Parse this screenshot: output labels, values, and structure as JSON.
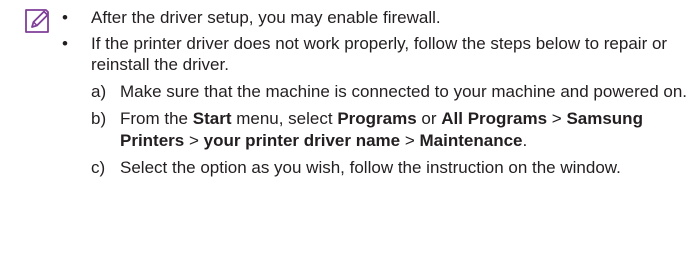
{
  "icons": {
    "note": "note-pencil-icon"
  },
  "colors": {
    "icon_accent": "#7f3f98",
    "text": "#231f20"
  },
  "bullet_glyph": "•",
  "bullets": [
    {
      "text": "After the driver setup, you may enable firewall."
    },
    {
      "text": "If the printer driver does not work properly, follow the steps below to repair or reinstall the driver.",
      "steps": [
        {
          "marker": "a)",
          "parts": [
            {
              "t": "Make sure that the machine is connected to your machine and powered on."
            }
          ]
        },
        {
          "marker": "b)",
          "parts": [
            {
              "t": "From the "
            },
            {
              "t": "Start",
              "b": true
            },
            {
              "t": " menu, select "
            },
            {
              "t": "Programs",
              "b": true
            },
            {
              "t": " or "
            },
            {
              "t": "All Programs",
              "b": true
            },
            {
              "t": " > "
            },
            {
              "t": "Samsung Printers",
              "b": true
            },
            {
              "t": " > "
            },
            {
              "t": "your printer driver name",
              "b": true
            },
            {
              "t": " > "
            },
            {
              "t": "Maintenance",
              "b": true
            },
            {
              "t": "."
            }
          ]
        },
        {
          "marker": "c)",
          "parts": [
            {
              "t": "Select the option as you wish, follow the instruction on the window."
            }
          ]
        }
      ]
    }
  ]
}
